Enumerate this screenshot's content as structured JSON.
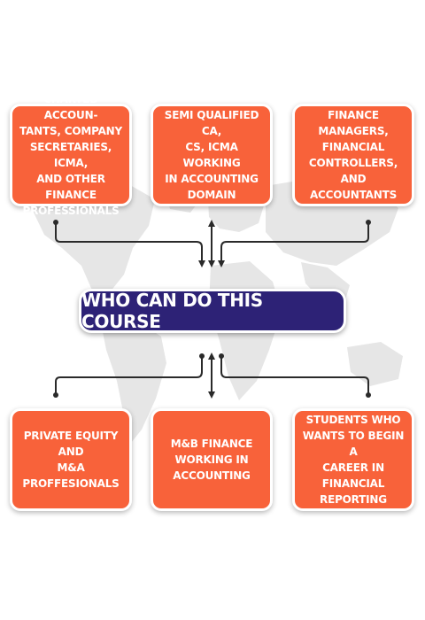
{
  "colors": {
    "box_fill": "#f8623a",
    "center_fill": "#2d2276",
    "connector": "#2a2a2a",
    "map": "#e4e4e4"
  },
  "center": {
    "label": "WHO CAN DO THIS COURSE"
  },
  "top_boxes": [
    {
      "label": "CHARTED ACCOUN-\nTANTS, COMPANY\nSECRETARIES, ICMA,\nAND OTHER FINANCE\nPROFESSIONALS"
    },
    {
      "label": "SEMI QUALIFIED CA,\nCS, ICMA WORKING\nIN ACCOUNTING\nDOMAIN"
    },
    {
      "label": "FINANCE MANAGERS,\nFINANCIAL\nCONTROLLERS, AND\nACCOUNTANTS"
    }
  ],
  "bottom_boxes": [
    {
      "label": "PRIVATE EQUITY AND\nM&A\nPROFFESIONALS"
    },
    {
      "label": "M&B FINANCE\nWORKING IN\nACCOUNTING"
    },
    {
      "label": "STUDENTS WHO\nWANTS TO BEGIN A\nCAREER IN\nFINANCIAL\nREPORTING"
    }
  ]
}
